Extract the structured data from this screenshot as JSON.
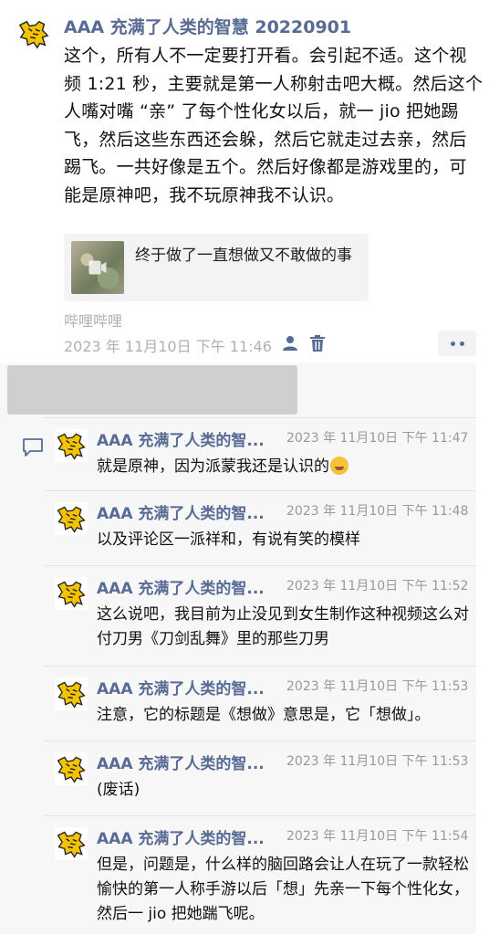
{
  "post": {
    "author": "AAA 充满了人类的智慧 20220901",
    "text": "这个，所有人不一定要打开看。会引起不适。这个视频 1:21 秒，主要就是第一人称射击吧大概。然后这个人嘴对嘴 “亲” 了每个性化女以后，就一 jio 把她踢飞，然后这些东西还会躲，然后它就走过去亲，然后踢飞。一共好像是五个。然后好像都是游戏里的，可能是原神吧，我不玩原神我不认识。",
    "link_title": "终于做了一直想做又不敢做的事",
    "source": "哔哩哔哩",
    "time": "2023 年 11月10日 下午 11:46"
  },
  "comments": [
    {
      "name": "AAA 充满了人类的智...",
      "time": "2023 年 11月10日 下午 11:47",
      "text": "就是原神，因为派蒙我还是认识的"
    },
    {
      "name": "AAA 充满了人类的智...",
      "time": "2023 年 11月10日 下午 11:48",
      "text": "以及评论区一派祥和，有说有笑的模样"
    },
    {
      "name": "AAA 充满了人类的智...",
      "time": "2023 年 11月10日 下午 11:52",
      "text": "这么说吧，我目前为止没见到女生制作这种视频这么对付刀男《刀剑乱舞》里的那些刀男"
    },
    {
      "name": "AAA 充满了人类的智...",
      "time": "2023 年 11月10日 下午 11:53",
      "text": "注意，它的标题是《想做》意思是，它「想做」。"
    },
    {
      "name": "AAA 充满了人类的智...",
      "time": "2023 年 11月10日 下午 11:53",
      "text": "(废话)"
    },
    {
      "name": "AAA 充满了人类的智...",
      "time": "2023 年 11月10日 下午 11:54",
      "text": "但是，问题是，什么样的脑回路会让人在玩了一款轻松愉快的第一人称手游以后「想」先亲一下每个性化女，然后一 jio 把她踹飞呢。"
    }
  ],
  "colors": {
    "name": "#576b95",
    "meta": "#b0b0b0",
    "comment_bg": "#f7f7f7"
  },
  "icons": [
    "tiger-avatar-icon",
    "video-play-icon",
    "friend-icon",
    "trash-icon",
    "more-icon",
    "comment-icon"
  ]
}
